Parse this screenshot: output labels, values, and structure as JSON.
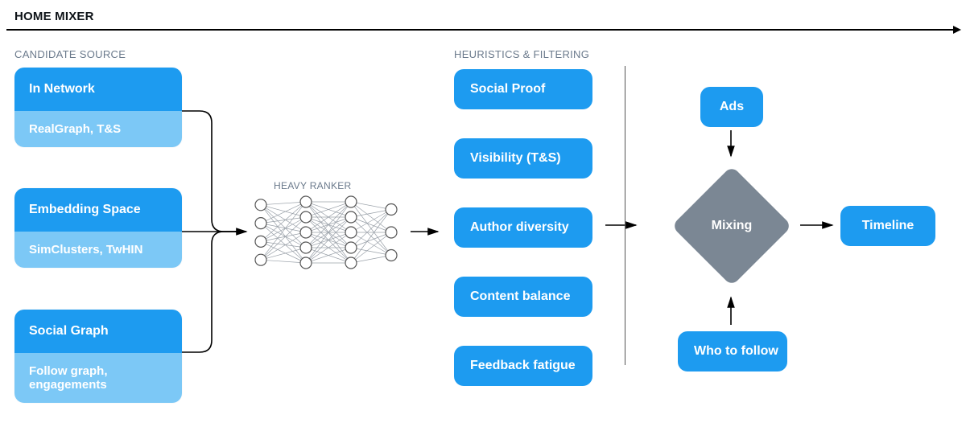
{
  "title": "HOME MIXER",
  "sections": {
    "candidate_source": "CANDIDATE SOURCE",
    "heavy_ranker": "HEAVY RANKER",
    "heuristics": "HEURISTICS & FILTERING"
  },
  "sources": [
    {
      "name": "In Network",
      "sub": "RealGraph, T&S"
    },
    {
      "name": "Embedding Space",
      "sub": "SimClusters, TwHIN"
    },
    {
      "name": "Social Graph",
      "sub": "Follow graph,\nengagements"
    }
  ],
  "heuristics": [
    "Social Proof",
    "Visibility (T&S)",
    "Author diversity",
    "Content balance",
    "Feedback fatigue"
  ],
  "inputs": {
    "ads": "Ads",
    "who_to_follow": "Who to follow"
  },
  "mixing": "Mixing",
  "output": "Timeline",
  "colors": {
    "primary": "#1d9bf0",
    "primary_light": "#7cc8f6",
    "diamond": "#7b8794",
    "label": "#6b7a8c"
  }
}
